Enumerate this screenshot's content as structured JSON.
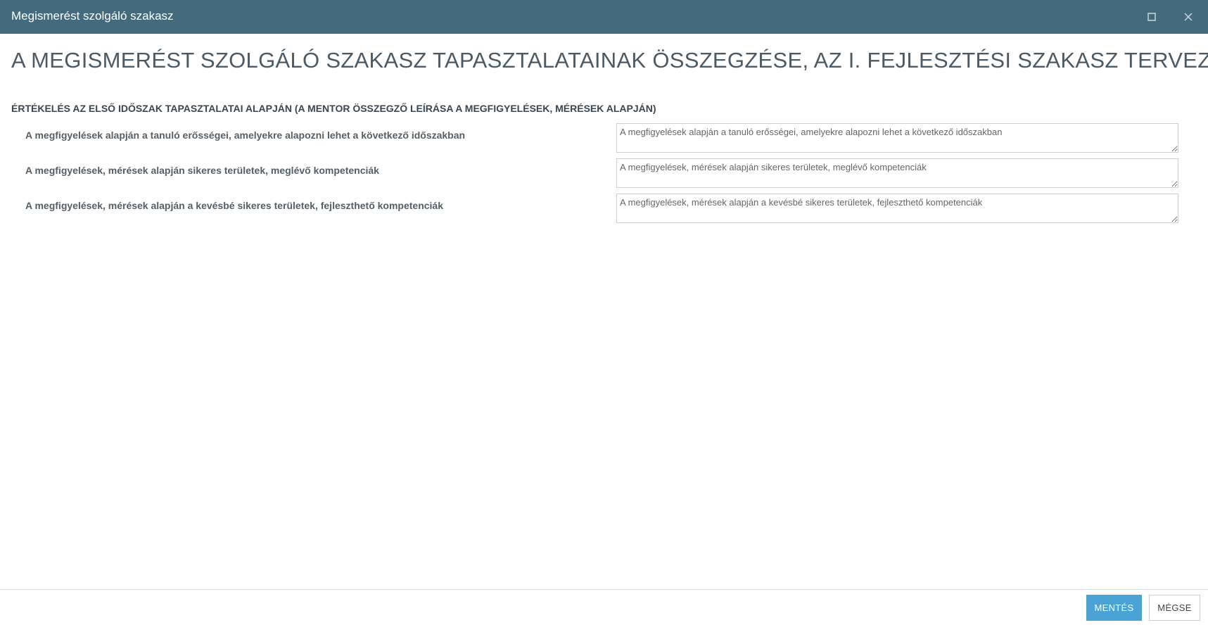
{
  "window": {
    "title": "Megismerést szolgáló szakasz",
    "maximize_icon": "maximize-icon",
    "close_icon": "close-icon",
    "titlebar_color": "#436a7d"
  },
  "page": {
    "title": "A MEGISMERÉST SZOLGÁLÓ SZAKASZ TAPASZTALATAINAK ÖSSZEGZÉSE, AZ I. FEJLESZTÉSI SZAKASZ TERVEZÉSE"
  },
  "section": {
    "heading": "ÉRTÉKELÉS AZ ELSŐ IDŐSZAK TAPASZTALATAI ALAPJÁN (A MENTOR ÖSSZEGZŐ LEÍRÁSA A MEGFIGYELÉSEK, MÉRÉSEK ALAPJÁN)",
    "fields": [
      {
        "label": "A megfigyelések alapján a tanuló erősségei, amelyekre alapozni lehet a következő időszakban",
        "value": "",
        "placeholder": "A megfigyelések alapján a tanuló erősségei, amelyekre alapozni lehet a következő időszakban"
      },
      {
        "label": "A megfigyelések, mérések alapján sikeres területek, meglévő kompetenciák",
        "value": "",
        "placeholder": "A megfigyelések, mérések alapján sikeres területek, meglévő kompetenciák"
      },
      {
        "label": "A megfigyelések, mérések alapján a kevésbé sikeres területek, fejleszthető kompetenciák",
        "value": "",
        "placeholder": "A megfigyelések, mérések alapján a kevésbé sikeres területek, fejleszthető kompetenciák"
      }
    ]
  },
  "footer": {
    "save_label": "MENTÉS",
    "cancel_label": "MÉGSE",
    "save_color": "#4aa3d4"
  }
}
